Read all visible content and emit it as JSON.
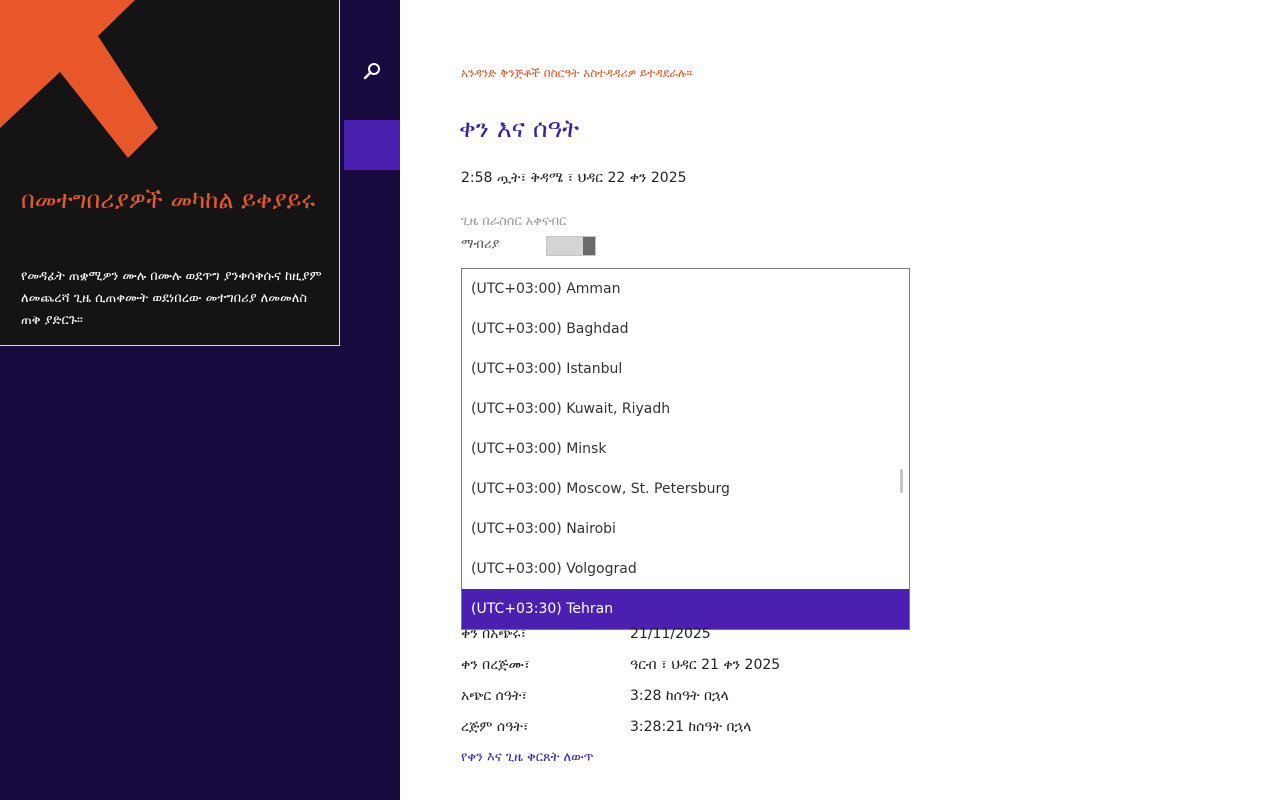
{
  "sidebar": {
    "search_icon": "search-icon",
    "tip": {
      "title": "በመተግበሪያዎች መካከል ይቀያይሩ",
      "body": "የመዳፊት ጠቋሚዎን ሙሉ በሙሉ ወደጥግ ያንቀሳቅሱና ከዚያም ለመጨረሻ ጊዜ ሲጠቀሙት ወደነበረው መተግበሪያ ለመመለስ ጠቅ ያድርጉ።",
      "arrow_color": "#e8572a"
    }
  },
  "main": {
    "managed_note": "አንዳንድ ቅንጅቶች በስርዓት አስተዳዳሪዎ ይተዳደራሉ።",
    "title": "ቀን እና ሰዓት",
    "current_time": "2:58 ጧት፣ ቅዳሜ ፣ ህዳር 22 ቀን 2025",
    "auto_time_label": "ጊዜ በራስሰር አቀናብር",
    "toggle_state": "ማብሪያ",
    "timezone_list": [
      "(UTC+03:00) Amman",
      "(UTC+03:00) Baghdad",
      "(UTC+03:00) Istanbul",
      "(UTC+03:00) Kuwait, Riyadh",
      "(UTC+03:00) Minsk",
      "(UTC+03:00) Moscow, St. Petersburg",
      "(UTC+03:00) Nairobi",
      "(UTC+03:00) Volgograd",
      "(UTC+03:30) Tehran"
    ],
    "selected_timezone": "(UTC+03:30) Tehran",
    "details": [
      {
        "label": "ቀን በአጭሩ፣",
        "value": "21/11/2025"
      },
      {
        "label": "ቀን በረጅሙ፣",
        "value": "ዓርብ ፣ ህዳር 21 ቀን 2025"
      },
      {
        "label": "አጭር ሰዓት፣",
        "value": "3:28 ከሰዓት በኋላ"
      },
      {
        "label": "ረጅም ሰዓት፣",
        "value": "3:28:21 ከሰዓት በኋላ"
      }
    ],
    "change_link": "የቀን እና ጊዜ ቅርጸት ለውጥ"
  },
  "colors": {
    "accent": "#4b20b0",
    "title": "#3a1fa3",
    "warning": "#d9531e",
    "sidebar_bg": "#180a3f"
  }
}
